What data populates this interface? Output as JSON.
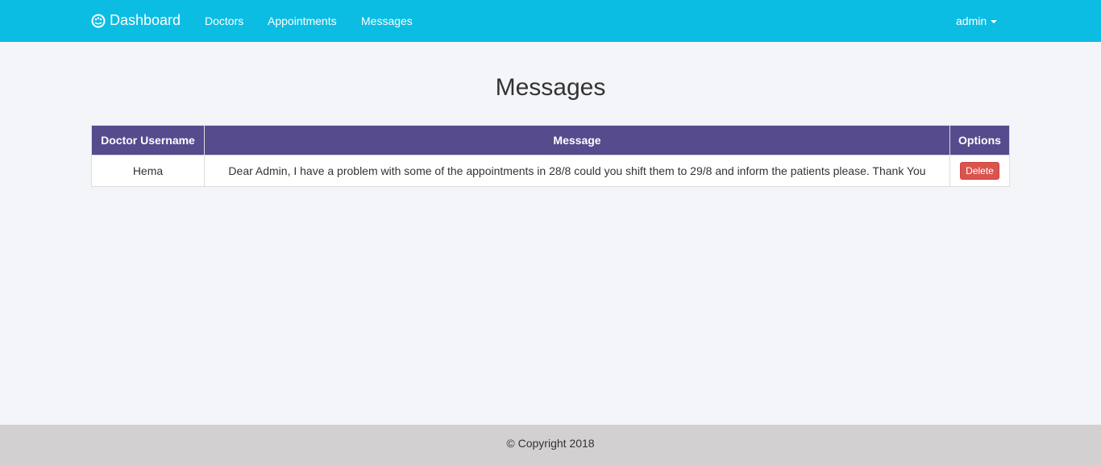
{
  "nav": {
    "brand": "Dashboard",
    "links": [
      "Doctors",
      "Appointments",
      "Messages"
    ],
    "user": "admin"
  },
  "page": {
    "title": "Messages"
  },
  "table": {
    "headers": [
      "Doctor Username",
      "Message",
      "Options"
    ],
    "rows": [
      {
        "doctor": "Hema",
        "message": "Dear Admin, I have a problem with some of the appointments in 28/8 could you shift them to 29/8 and inform the patients please. Thank You",
        "action": "Delete"
      }
    ]
  },
  "footer": {
    "text": "© Copyright 2018"
  }
}
